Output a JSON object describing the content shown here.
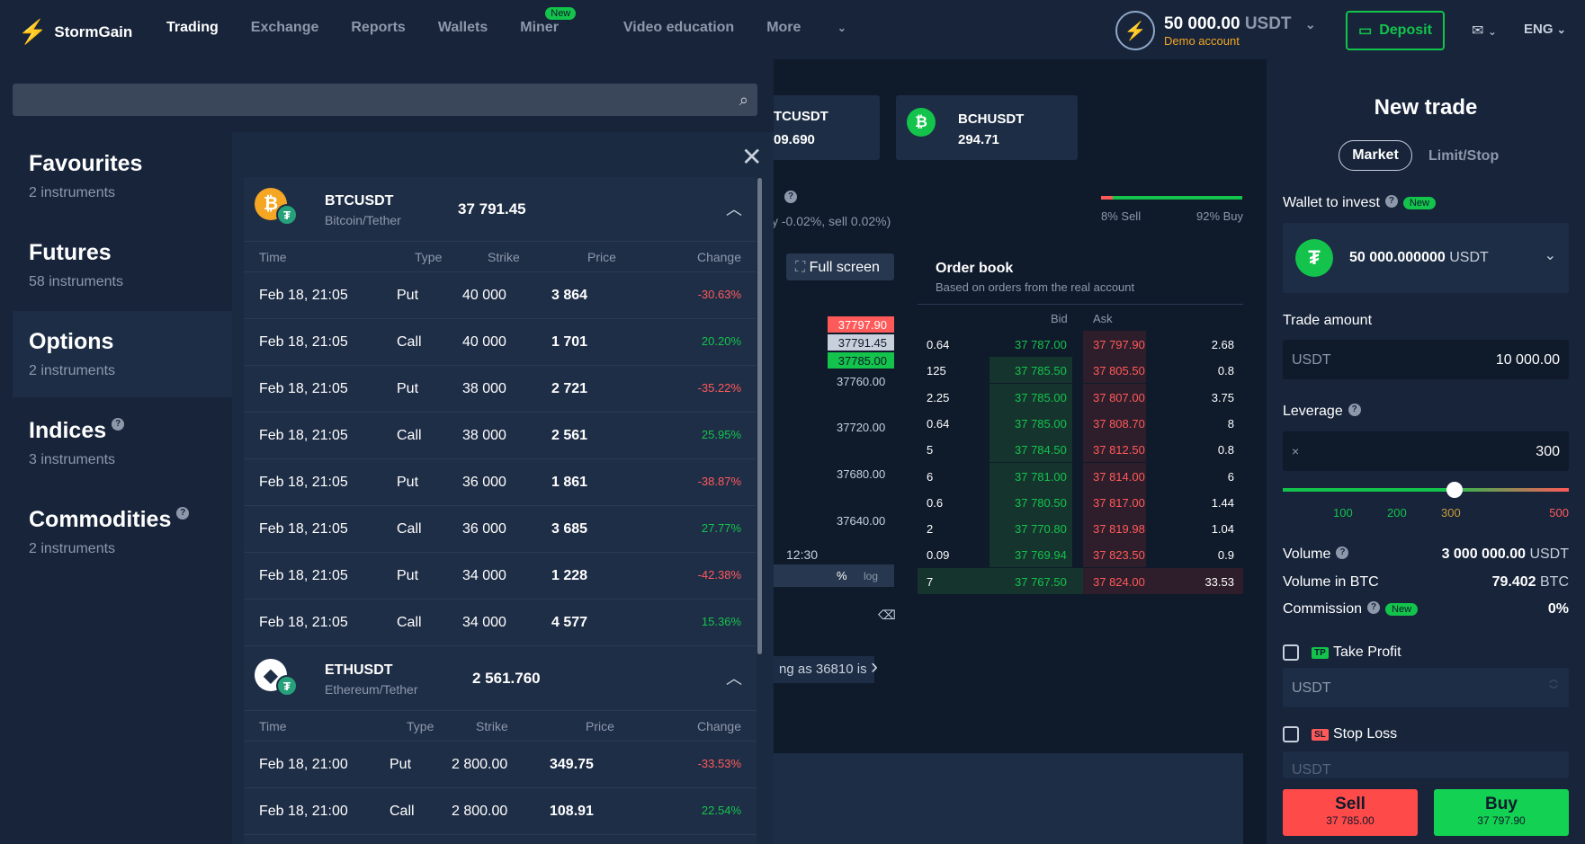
{
  "header": {
    "brand": "StormGain",
    "nav": [
      "Trading",
      "Exchange",
      "Reports",
      "Wallets",
      "Miner",
      "Video education",
      "More"
    ],
    "miner_badge": "New",
    "balance_amount": "50 000.00",
    "balance_currency": "USDT",
    "account_type": "Demo account",
    "deposit": "Deposit",
    "language": "ENG"
  },
  "background": {
    "tile1_symbol": "TCUSDT",
    "tile1_price": "09.690",
    "tile2_symbol": "BCHUSDT",
    "tile2_price": "294.71",
    "fee_text": "y -0.02%, sell 0.02%)",
    "sell_pct": "8% Sell",
    "buy_pct": "92% Buy",
    "fullscreen": "Full screen",
    "chart_prices": [
      "37797.90",
      "37791.45",
      "37785.00",
      "37760.00",
      "37720.00",
      "37680.00",
      "37640.00"
    ],
    "chart_time": "12:30",
    "chart_pct": "%",
    "chart_log": "log",
    "alert_text": "ng as 36810 is"
  },
  "orderbook": {
    "title": "Order book",
    "subtitle": "Based on orders from the real account",
    "bid_label": "Bid",
    "ask_label": "Ask",
    "rows": [
      [
        "0.64",
        "37 787.00",
        "37 797.90",
        "2.68"
      ],
      [
        "125",
        "37 785.50",
        "37 805.50",
        "0.8"
      ],
      [
        "2.25",
        "37 785.00",
        "37 807.00",
        "3.75"
      ],
      [
        "0.64",
        "37 785.00",
        "37 808.70",
        "8"
      ],
      [
        "5",
        "37 784.50",
        "37 812.50",
        "0.8"
      ],
      [
        "6",
        "37 781.00",
        "37 814.00",
        "6"
      ],
      [
        "0.6",
        "37 780.50",
        "37 817.00",
        "1.44"
      ],
      [
        "2",
        "37 770.80",
        "37 819.98",
        "1.04"
      ],
      [
        "0.09",
        "37 769.94",
        "37 823.50",
        "0.9"
      ],
      [
        "7",
        "37 767.50",
        "37 824.00",
        "33.53"
      ]
    ]
  },
  "search": {
    "placeholder": ""
  },
  "categories": [
    {
      "name": "Favourites",
      "count": "2 instruments"
    },
    {
      "name": "Futures",
      "count": "58 instruments"
    },
    {
      "name": "Options",
      "count": "2 instruments"
    },
    {
      "name": "Indices",
      "count": "3 instruments"
    },
    {
      "name": "Commodities",
      "count": "2 instruments"
    }
  ],
  "help_icon": "?",
  "columns": [
    "Time",
    "Type",
    "Strike",
    "Price",
    "Change"
  ],
  "btc": {
    "symbol": "BTCUSDT",
    "name": "Bitcoin/Tether",
    "price": "37 791.45",
    "rows": [
      [
        "Feb 18, 21:05",
        "Put",
        "40 000",
        "3 864",
        "-30.63%"
      ],
      [
        "Feb 18, 21:05",
        "Call",
        "40 000",
        "1 701",
        "20.20%"
      ],
      [
        "Feb 18, 21:05",
        "Put",
        "38 000",
        "2 721",
        "-35.22%"
      ],
      [
        "Feb 18, 21:05",
        "Call",
        "38 000",
        "2 561",
        "25.95%"
      ],
      [
        "Feb 18, 21:05",
        "Put",
        "36 000",
        "1 861",
        "-38.87%"
      ],
      [
        "Feb 18, 21:05",
        "Call",
        "36 000",
        "3 685",
        "27.77%"
      ],
      [
        "Feb 18, 21:05",
        "Put",
        "34 000",
        "1 228",
        "-42.38%"
      ],
      [
        "Feb 18, 21:05",
        "Call",
        "34 000",
        "4 577",
        "15.36%"
      ]
    ]
  },
  "eth": {
    "symbol": "ETHUSDT",
    "name": "Ethereum/Tether",
    "price": "2 561.760",
    "rows": [
      [
        "Feb 18, 21:00",
        "Put",
        "2 800.00",
        "349.75",
        "-33.53%"
      ],
      [
        "Feb 18, 21:00",
        "Call",
        "2 800.00",
        "108.91",
        "22.54%"
      ]
    ]
  },
  "trade": {
    "title": "New trade",
    "tab_market": "Market",
    "tab_limit": "Limit/Stop",
    "wallet_label": "Wallet to invest",
    "new_badge": "New",
    "wallet_amount": "50 000.000000",
    "wallet_currency": "USDT",
    "amount_label": "Trade amount",
    "amount_currency": "USDT",
    "amount_value": "10 000.00",
    "leverage_label": "Leverage",
    "leverage_prefix": "×",
    "leverage_value": "300",
    "leverage_level": 300,
    "leverage_max": 500,
    "leverage_marks": [
      "100",
      "200",
      "300",
      "500"
    ],
    "volume_label": "Volume",
    "volume_value": "3 000 000.00",
    "volume_currency": "USDT",
    "volume_btc_label": "Volume in BTC",
    "volume_btc_value": "79.402",
    "volume_btc_currency": "BTC",
    "commission_label": "Commission",
    "commission_value": "0%",
    "tp_tag": "TP",
    "tp_label": "Take Profit",
    "tp_currency": "USDT",
    "sl_tag": "SL",
    "sl_label": "Stop Loss",
    "sl_currency": "USDT",
    "sell_label": "Sell",
    "sell_price": "37 785.00",
    "buy_label": "Buy",
    "buy_price": "37 797.90"
  },
  "colors": {
    "green": "#13c34b",
    "red": "#ff5a5a",
    "orange": "#f5a623"
  }
}
